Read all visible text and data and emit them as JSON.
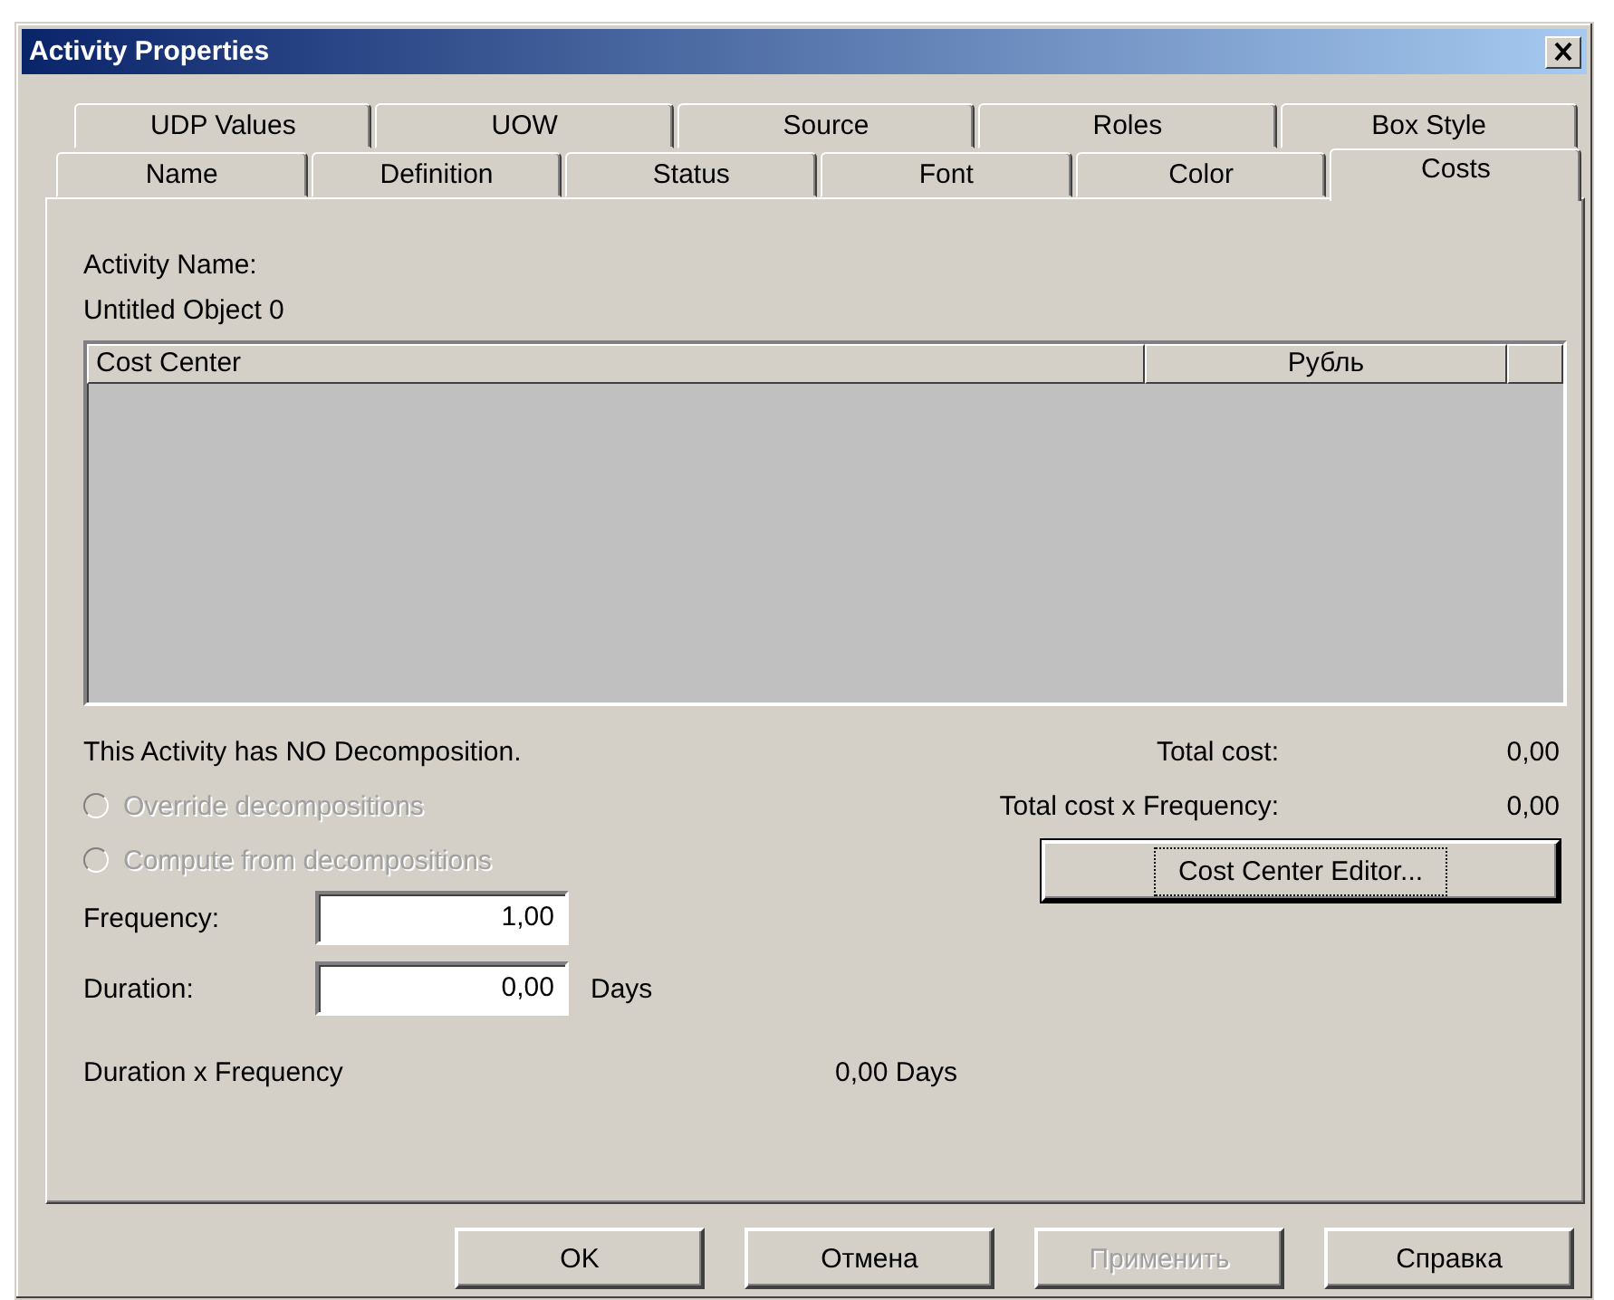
{
  "window": {
    "title": "Activity Properties"
  },
  "tab_rows": [
    [
      {
        "label": "UDP Values",
        "selected": false
      },
      {
        "label": "UOW",
        "selected": false
      },
      {
        "label": "Source",
        "selected": false
      },
      {
        "label": "Roles",
        "selected": false
      },
      {
        "label": "Box Style",
        "selected": false
      }
    ],
    [
      {
        "label": "Name",
        "selected": false
      },
      {
        "label": "Definition",
        "selected": false
      },
      {
        "label": "Status",
        "selected": false
      },
      {
        "label": "Font",
        "selected": false
      },
      {
        "label": "Color",
        "selected": false
      },
      {
        "label": "Costs",
        "selected": true
      }
    ]
  ],
  "activity_name": {
    "label": "Activity Name:",
    "value": "Untitled Object 0"
  },
  "table": {
    "columns": [
      "Cost Center",
      "Рубль"
    ]
  },
  "decomposition_note": "This Activity has NO Decomposition.",
  "radios": [
    {
      "label": "Override decompositions",
      "selected": false,
      "disabled": true
    },
    {
      "label": "Compute from decompositions",
      "selected": false,
      "disabled": true
    }
  ],
  "totals": [
    {
      "label": "Total cost:",
      "value": "0,00"
    },
    {
      "label": "Total cost x Frequency:",
      "value": "0,00"
    }
  ],
  "cost_center_editor_button": {
    "label": "Cost Center Editor...",
    "focused": true
  },
  "frequency": {
    "label": "Frequency:",
    "value": "1,00"
  },
  "duration": {
    "label": "Duration:",
    "value": "0,00",
    "unit": "Days"
  },
  "duration_x_frequency": {
    "label": "Duration x Frequency",
    "value": "0,00 Days"
  },
  "buttons": [
    {
      "label": "OK",
      "disabled": false
    },
    {
      "label": "Отмена",
      "disabled": false
    },
    {
      "label": "Применить",
      "disabled": true
    },
    {
      "label": "Справка",
      "disabled": false
    }
  ]
}
